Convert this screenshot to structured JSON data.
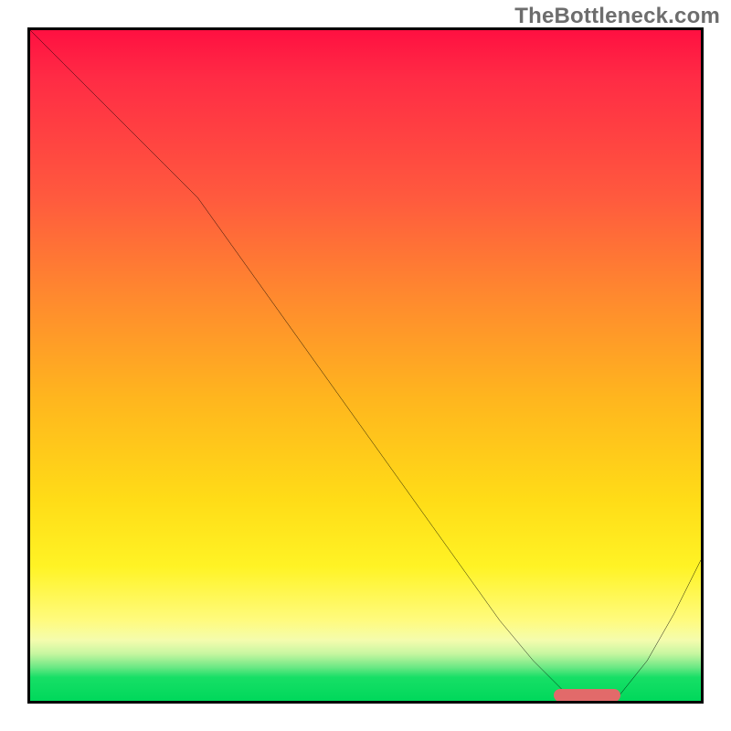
{
  "watermark": "TheBottleneck.com",
  "colors": {
    "border": "#000000",
    "curve": "#000000",
    "marker": "#e26a6a"
  },
  "chart_data": {
    "type": "line",
    "title": "",
    "xlabel": "",
    "ylabel": "",
    "xlim": [
      0,
      100
    ],
    "ylim": [
      0,
      100
    ],
    "grid": false,
    "legend": false,
    "background": "red-yellow-green vertical gradient (red=top, green=bottom)",
    "series": [
      {
        "name": "bottleneck-curve",
        "x": [
          0,
          5,
          10,
          15,
          20,
          25,
          30,
          35,
          40,
          45,
          50,
          55,
          60,
          65,
          70,
          75,
          78,
          80,
          82,
          85,
          88,
          92,
          96,
          100
        ],
        "y": [
          100,
          95,
          90,
          85,
          80,
          75,
          68,
          61,
          54,
          47,
          40,
          33,
          26,
          19,
          12,
          6,
          3,
          1,
          0,
          0,
          1,
          6,
          13,
          21
        ]
      }
    ],
    "annotations": [
      {
        "name": "optimal-zone-marker",
        "shape": "rounded-bar",
        "x_range": [
          78,
          88
        ],
        "y": 0.8,
        "color": "#e26a6a"
      }
    ]
  }
}
